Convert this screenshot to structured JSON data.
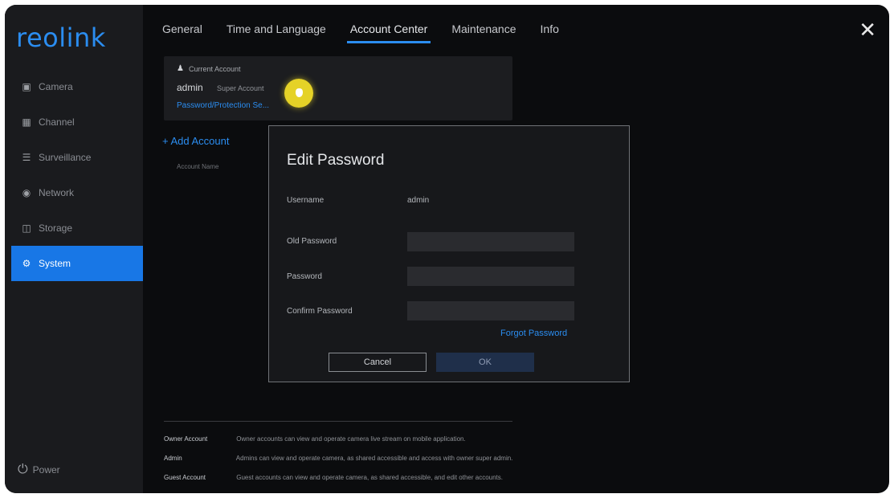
{
  "brand": {
    "logo": "reolink",
    "accent": "#2b8df0",
    "active_bg": "#1877e6"
  },
  "sidebar": {
    "items": [
      {
        "label": "Camera",
        "icon": "camera-icon"
      },
      {
        "label": "Channel",
        "icon": "channel-icon"
      },
      {
        "label": "Surveillance",
        "icon": "list-icon"
      },
      {
        "label": "Network",
        "icon": "globe-icon"
      },
      {
        "label": "Storage",
        "icon": "storage-icon"
      },
      {
        "label": "System",
        "icon": "gear-icon",
        "active": true
      }
    ],
    "power": "Power"
  },
  "tabs": [
    "General",
    "Time and Language",
    "Account Center",
    "Maintenance",
    "Info"
  ],
  "active_tab": "Account Center",
  "account": {
    "header": "Current Account",
    "name": "admin",
    "role": "Super Account",
    "link": "Password/Protection Se...",
    "add": "+ Add Account",
    "column": "Account Name"
  },
  "dialog": {
    "title": "Edit Password",
    "username_label": "Username",
    "username_value": "admin",
    "old_password_label": "Old Password",
    "password_label": "Password",
    "confirm_label": "Confirm Password",
    "forgot": "Forgot Password",
    "cancel": "Cancel",
    "ok": "OK"
  },
  "legend": [
    {
      "key": "Owner Account",
      "value": "Owner accounts can view and operate camera live stream on mobile application."
    },
    {
      "key": "Admin",
      "value": "Admins can view and operate camera, as shared accessible and access with owner super admin."
    },
    {
      "key": "Guest Account",
      "value": "Guest accounts can view and operate camera, as shared accessible, and edit other accounts."
    }
  ]
}
